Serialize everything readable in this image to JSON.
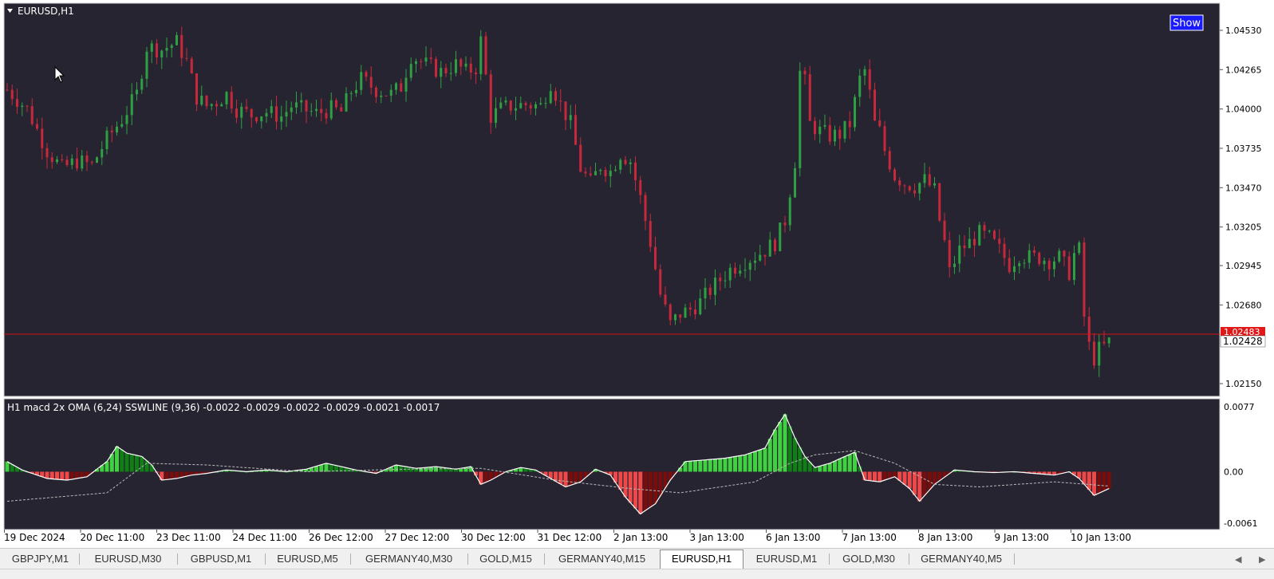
{
  "chart": {
    "symbol_label": "EURUSD,H1",
    "show_button": "Show",
    "price_ticks": [
      "1.04530",
      "1.04265",
      "1.04000",
      "1.03735",
      "1.03470",
      "1.03205",
      "1.02945",
      "1.02680",
      "1.02150"
    ],
    "bid_label": "1.02483",
    "current_price_label": "1.02428",
    "indicator_label": "H1 macd 2x OMA (6,24) SSWLINE (9,36)  -0.0022 -0.0029 -0.0022 -0.0029 -0.0021 -0.0017",
    "indicator_ticks": [
      "0.0077",
      "0.00",
      "-0.0061"
    ],
    "time_ticks": [
      "19 Dec 2024",
      "20 Dec 11:00",
      "23 Dec 11:00",
      "24 Dec 11:00",
      "26 Dec 12:00",
      "27 Dec 12:00",
      "30 Dec 12:00",
      "31 Dec 12:00",
      "2 Jan 13:00",
      "3 Jan 13:00",
      "6 Jan 13:00",
      "7 Jan 13:00",
      "8 Jan 13:00",
      "9 Jan 13:00",
      "10 Jan 13:00"
    ],
    "colors": {
      "background": "#272431",
      "bull_candle": "#2ea043",
      "bear_candle": "#c8283c",
      "price_line": "#d01414",
      "hist_green_light": "#3fd13f",
      "hist_green_dark": "#0f7f16",
      "hist_red_light": "#f04848",
      "hist_red_dark": "#7a0c0c",
      "macd_line": "#ffffff",
      "signal_line": "#b8b8b8"
    }
  },
  "chart_data": {
    "type": "candlestick",
    "title": "EURUSD,H1",
    "ylim": [
      1.02,
      1.0468
    ],
    "last_price": 1.02428,
    "bid": 1.02483,
    "path": [
      [
        0,
        1.0413
      ],
      [
        4,
        1.04
      ],
      [
        8,
        1.0372
      ],
      [
        11,
        1.036
      ],
      [
        14,
        1.0365
      ],
      [
        17,
        1.0362
      ],
      [
        20,
        1.038
      ],
      [
        23,
        1.0393
      ],
      [
        26,
        1.041
      ],
      [
        28,
        1.0442
      ],
      [
        31,
        1.044
      ],
      [
        34,
        1.0445
      ],
      [
        36,
        1.0432
      ],
      [
        38,
        1.0408
      ],
      [
        40,
        1.0402
      ],
      [
        42,
        1.0405
      ],
      [
        44,
        1.041
      ],
      [
        46,
        1.04
      ],
      [
        49,
        1.0396
      ],
      [
        52,
        1.0398
      ],
      [
        55,
        1.0395
      ],
      [
        57,
        1.0402
      ],
      [
        60,
        1.0399
      ],
      [
        62,
        1.0397
      ],
      [
        65,
        1.04
      ],
      [
        67,
        1.0398
      ],
      [
        69,
        1.0412
      ],
      [
        71,
        1.042
      ],
      [
        74,
        1.0413
      ],
      [
        77,
        1.041
      ],
      [
        79,
        1.0415
      ],
      [
        81,
        1.0436
      ],
      [
        84,
        1.043
      ],
      [
        87,
        1.0425
      ],
      [
        90,
        1.043
      ],
      [
        92,
        1.0425
      ],
      [
        94,
        1.0428
      ],
      [
        95,
        1.0446
      ],
      [
        96,
        1.0422
      ],
      [
        97,
        1.0395
      ],
      [
        99,
        1.04
      ],
      [
        101,
        1.0402
      ],
      [
        104,
        1.0403
      ],
      [
        107,
        1.0402
      ],
      [
        109,
        1.0418
      ],
      [
        111,
        1.0403
      ],
      [
        113,
        1.039
      ],
      [
        115,
        1.036
      ],
      [
        117,
        1.035
      ],
      [
        119,
        1.0362
      ],
      [
        121,
        1.0358
      ],
      [
        123,
        1.037
      ],
      [
        125,
        1.0365
      ],
      [
        127,
        1.034
      ],
      [
        129,
        1.031
      ],
      [
        131,
        1.0275
      ],
      [
        133,
        1.0255
      ],
      [
        135,
        1.0262
      ],
      [
        137,
        1.0265
      ],
      [
        139,
        1.027
      ],
      [
        141,
        1.0278
      ],
      [
        143,
        1.0285
      ],
      [
        145,
        1.0292
      ],
      [
        147,
        1.0296
      ],
      [
        150,
        1.0301
      ],
      [
        152,
        1.0305
      ],
      [
        154,
        1.031
      ],
      [
        156,
        1.0325
      ],
      [
        158,
        1.0365
      ],
      [
        159,
        1.0425
      ],
      [
        160,
        1.0418
      ],
      [
        161,
        1.039
      ],
      [
        163,
        1.0385
      ],
      [
        165,
        1.0382
      ],
      [
        167,
        1.0383
      ],
      [
        169,
        1.039
      ],
      [
        171,
        1.042
      ],
      [
        172,
        1.0426
      ],
      [
        173,
        1.041
      ],
      [
        174,
        1.039
      ],
      [
        175,
        1.0385
      ],
      [
        176,
        1.0372
      ],
      [
        178,
        1.0355
      ],
      [
        180,
        1.035
      ],
      [
        182,
        1.0348
      ],
      [
        184,
        1.0352
      ],
      [
        186,
        1.0345
      ],
      [
        187,
        1.0325
      ],
      [
        188,
        1.031
      ],
      [
        189,
        1.029
      ],
      [
        191,
        1.0305
      ],
      [
        193,
        1.031
      ],
      [
        195,
        1.0316
      ],
      [
        197,
        1.0313
      ],
      [
        199,
        1.0305
      ],
      [
        201,
        1.0295
      ],
      [
        203,
        1.0302
      ],
      [
        205,
        1.03
      ],
      [
        207,
        1.03
      ],
      [
        209,
        1.0298
      ],
      [
        211,
        1.03
      ],
      [
        213,
        1.029
      ],
      [
        214,
        1.0302
      ],
      [
        215,
        1.0305
      ],
      [
        216,
        1.026
      ],
      [
        217,
        1.024
      ],
      [
        218,
        1.0232
      ],
      [
        219,
        1.0238
      ],
      [
        220,
        1.024
      ],
      [
        221,
        1.0243
      ]
    ],
    "macd_path": [
      [
        0,
        0.0012
      ],
      [
        3,
        0.0002
      ],
      [
        8,
        -0.0008
      ],
      [
        12,
        -0.001
      ],
      [
        16,
        -0.0006
      ],
      [
        20,
        0.0012
      ],
      [
        22,
        0.003
      ],
      [
        24,
        0.0022
      ],
      [
        27,
        0.0018
      ],
      [
        29,
        0.0008
      ],
      [
        31,
        -0.001
      ],
      [
        34,
        -0.0008
      ],
      [
        37,
        -0.0004
      ],
      [
        40,
        -0.0002
      ],
      [
        44,
        0.0002
      ],
      [
        48,
        0.0
      ],
      [
        52,
        0.0002
      ],
      [
        56,
        0.0
      ],
      [
        60,
        0.0003
      ],
      [
        64,
        0.001
      ],
      [
        67,
        0.0006
      ],
      [
        70,
        0.0002
      ],
      [
        74,
        -0.0002
      ],
      [
        78,
        0.0008
      ],
      [
        82,
        0.0004
      ],
      [
        86,
        0.0006
      ],
      [
        90,
        0.0003
      ],
      [
        93,
        0.0006
      ],
      [
        95,
        -0.0015
      ],
      [
        97,
        -0.001
      ],
      [
        100,
        0.0
      ],
      [
        103,
        0.0005
      ],
      [
        106,
        0.0002
      ],
      [
        109,
        -0.0008
      ],
      [
        112,
        -0.0018
      ],
      [
        115,
        -0.0012
      ],
      [
        118,
        0.0003
      ],
      [
        121,
        -0.0004
      ],
      [
        124,
        -0.003
      ],
      [
        127,
        -0.005
      ],
      [
        130,
        -0.0038
      ],
      [
        133,
        -0.001
      ],
      [
        136,
        0.0012
      ],
      [
        140,
        0.0014
      ],
      [
        144,
        0.0016
      ],
      [
        148,
        0.002
      ],
      [
        152,
        0.0028
      ],
      [
        154,
        0.005
      ],
      [
        156,
        0.0068
      ],
      [
        158,
        0.004
      ],
      [
        160,
        0.0018
      ],
      [
        162,
        0.0005
      ],
      [
        165,
        0.001
      ],
      [
        168,
        0.0018
      ],
      [
        170,
        0.0023
      ],
      [
        172,
        -0.001
      ],
      [
        175,
        -0.0012
      ],
      [
        178,
        -0.0006
      ],
      [
        181,
        -0.002
      ],
      [
        183,
        -0.0035
      ],
      [
        186,
        -0.0015
      ],
      [
        190,
        0.0002
      ],
      [
        194,
        0.0
      ],
      [
        198,
        -0.0001
      ],
      [
        202,
        0.0
      ],
      [
        206,
        -0.0002
      ],
      [
        210,
        -0.0004
      ],
      [
        213,
        0.0
      ],
      [
        215,
        -0.0008
      ],
      [
        218,
        -0.0028
      ],
      [
        221,
        -0.002
      ]
    ],
    "signal_path": [
      [
        0,
        -0.0035
      ],
      [
        20,
        -0.0025
      ],
      [
        28,
        0.001
      ],
      [
        40,
        0.0008
      ],
      [
        60,
        0.0
      ],
      [
        80,
        0.0003
      ],
      [
        95,
        0.0004
      ],
      [
        110,
        -0.001
      ],
      [
        125,
        -0.002
      ],
      [
        135,
        -0.0025
      ],
      [
        150,
        -0.0012
      ],
      [
        157,
        0.001
      ],
      [
        162,
        0.002
      ],
      [
        170,
        0.0025
      ],
      [
        178,
        0.001
      ],
      [
        186,
        -0.0015
      ],
      [
        195,
        -0.0018
      ],
      [
        210,
        -0.0012
      ],
      [
        221,
        -0.0017
      ]
    ],
    "macd_ylim": [
      -0.0061,
      0.0077
    ]
  },
  "tabs": [
    {
      "label": "GBPJPY,M1",
      "active": false
    },
    {
      "label": "EURUSD,M30",
      "active": false
    },
    {
      "label": "GBPUSD,M1",
      "active": false
    },
    {
      "label": "EURUSD,M5",
      "active": false
    },
    {
      "label": "GERMANY40,M30",
      "active": false
    },
    {
      "label": "GOLD,M15",
      "active": false
    },
    {
      "label": "GERMANY40,M15",
      "active": false
    },
    {
      "label": "EURUSD,H1",
      "active": true
    },
    {
      "label": "EURUSD,M1",
      "active": false
    },
    {
      "label": "GOLD,M30",
      "active": false
    },
    {
      "label": "GERMANY40,M5",
      "active": false
    }
  ],
  "scroll": {
    "left": "◀",
    "right": "▶"
  }
}
